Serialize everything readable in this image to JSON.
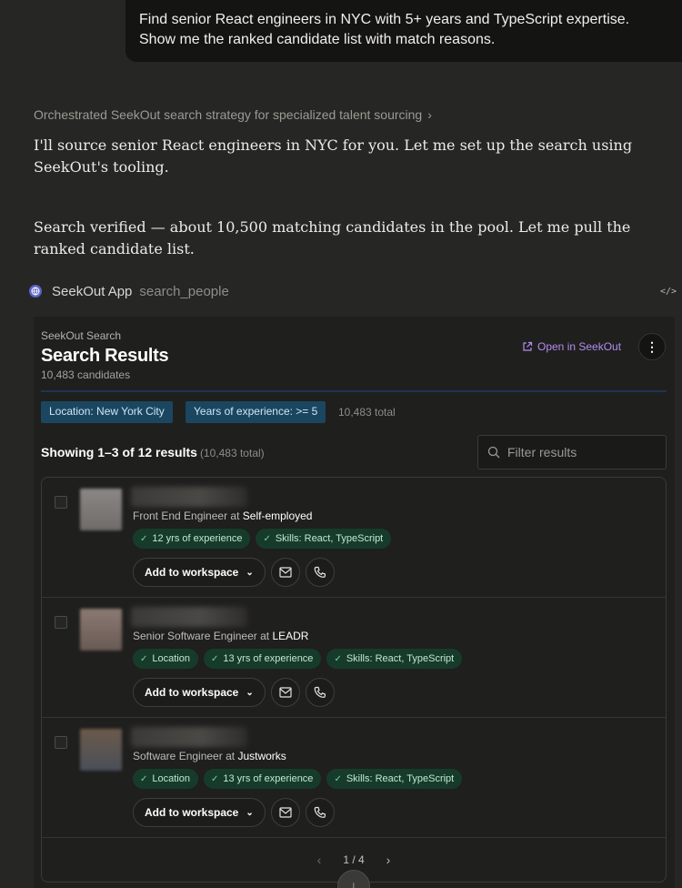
{
  "user_message": "Find senior React engineers in NYC with 5+ years and TypeScript expertise. Show me the ranked candidate list with match reasons.",
  "thought_summary": "Orchestrated SeekOut search strategy for specialized talent sourcing",
  "assistant_paragraphs": [
    "I'll source senior React engineers in NYC for you. Let me set up the search using SeekOut's tooling.",
    "Search verified — about 10,500 matching candidates in the pool. Let me pull the ranked candidate list."
  ],
  "tool_call": {
    "app": "SeekOut App",
    "function": "search_people"
  },
  "widget": {
    "subtitle": "SeekOut Search",
    "title": "Search Results",
    "count": "10,483 candidates",
    "open_link": "Open in SeekOut",
    "filters": [
      "Location: New York City",
      "Years of experience: >= 5"
    ],
    "filters_total": "10,483 total",
    "showing": "Showing 1–3 of 12 results",
    "showing_total": "(10,483 total)",
    "filter_placeholder": "Filter results",
    "candidates": [
      {
        "title": "Front End Engineer",
        "at": "at",
        "company": "Self-employed",
        "tags": [
          "12 yrs of experience",
          "Skills: React, TypeScript"
        ]
      },
      {
        "title": "Senior Software Engineer",
        "at": "at",
        "company": "LEADR",
        "tags": [
          "Location",
          "13 yrs of experience",
          "Skills: React, TypeScript"
        ]
      },
      {
        "title": "Software Engineer",
        "at": "at",
        "company": "Justworks",
        "tags": [
          "Location",
          "13 yrs of experience",
          "Skills: React, TypeScript"
        ]
      }
    ],
    "add_to_workspace": "Add to workspace",
    "pagination": "1 / 4"
  },
  "colors": {
    "tag_bg": "#173b2b",
    "chip_bg": "#1a4660",
    "link": "#b48cf0"
  }
}
